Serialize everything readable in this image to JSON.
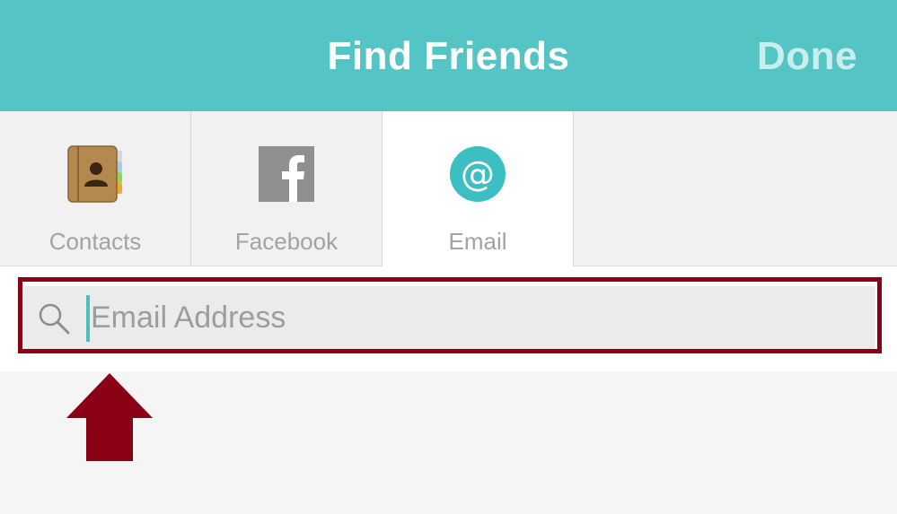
{
  "header": {
    "title": "Find Friends",
    "done_label": "Done",
    "background_color": "#55c4c4"
  },
  "tabs": [
    {
      "label": "Contacts",
      "icon": "contacts-book-icon",
      "selected": false
    },
    {
      "label": "Facebook",
      "icon": "facebook-icon",
      "selected": false
    },
    {
      "label": "Email",
      "icon": "at-sign-icon",
      "selected": true
    }
  ],
  "search": {
    "placeholder": "Email Address",
    "value": "",
    "icon": "search-icon"
  },
  "annotation": {
    "highlight_color": "#8a0014",
    "arrow_icon": "up-arrow-icon"
  }
}
